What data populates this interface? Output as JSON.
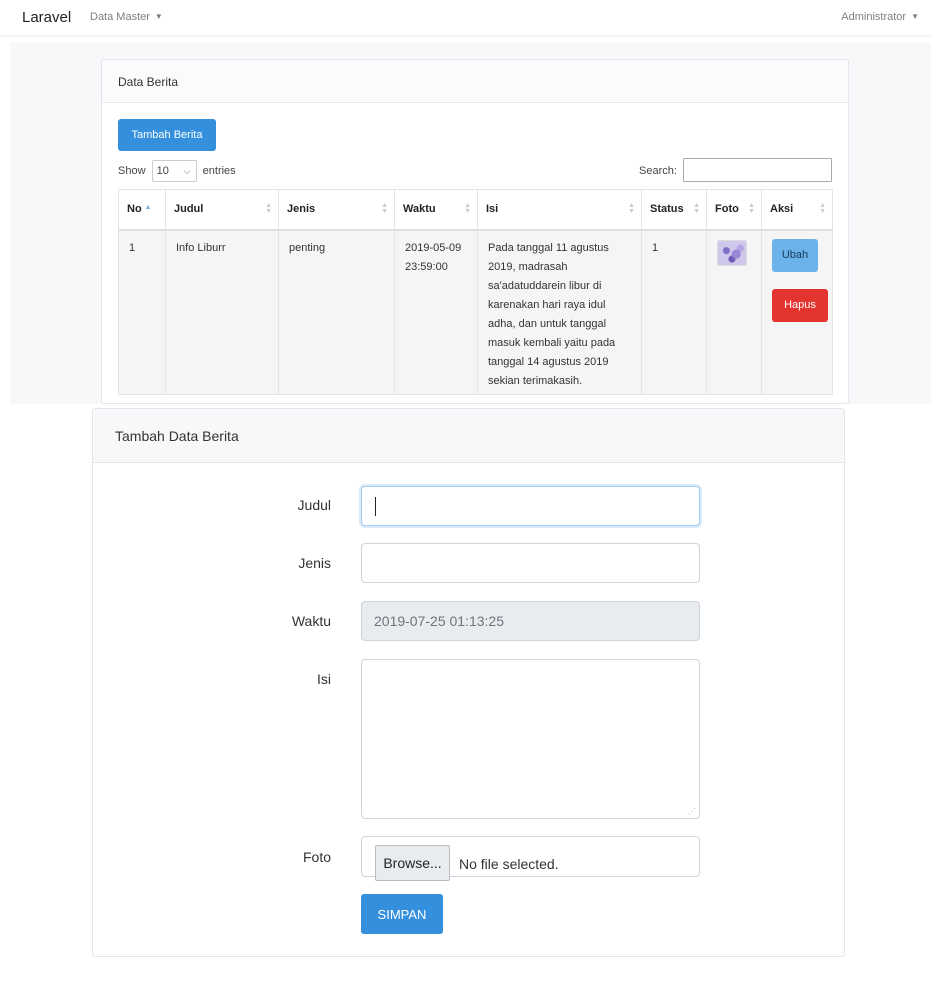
{
  "navbar": {
    "brand": "Laravel",
    "menu_label": "Data Master",
    "user_label": "Administrator",
    "caret": "▼"
  },
  "list_card": {
    "title": "Data Berita",
    "add_button": "Tambah Berita",
    "show_label": "Show",
    "entries_value": "10",
    "entries_label": "entries",
    "search_label": "Search:",
    "columns": [
      "No",
      "Judul",
      "Jenis",
      "Waktu",
      "Isi",
      "Status",
      "Foto",
      "Aksi"
    ],
    "rows": [
      {
        "no": "1",
        "judul": "Info Liburr",
        "jenis": "penting",
        "waktu": "2019-05-09 23:59:00",
        "isi": "Pada tanggal 11 agustus 2019, madrasah sa'adatuddarein libur di karenakan hari raya idul adha, dan untuk tanggal masuk kembali yaitu pada tanggal 14 agustus 2019 sekian terimakasih.",
        "status": "1",
        "ubah_label": "Ubah",
        "hapus_label": "Hapus"
      }
    ]
  },
  "form_card": {
    "title": "Tambah Data Berita",
    "judul_label": "Judul",
    "judul_value": "",
    "jenis_label": "Jenis",
    "jenis_value": "",
    "waktu_label": "Waktu",
    "waktu_value": "2019-07-25 01:13:25",
    "isi_label": "Isi",
    "isi_value": "",
    "foto_label": "Foto",
    "browse_label": "Browse...",
    "file_status": "No file selected.",
    "submit_label": "SIMPAN"
  },
  "colors": {
    "primary": "#3490dc",
    "info": "#6cb2eb",
    "danger": "#e3342f"
  }
}
